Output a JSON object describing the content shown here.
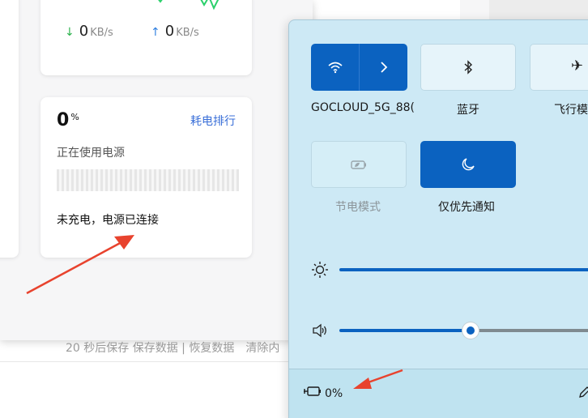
{
  "app": {
    "network": {
      "download_value": "0",
      "download_unit": "KB/s",
      "upload_value": "0",
      "upload_unit": "KB/s",
      "download_icon": "arrow-down-icon",
      "upload_icon": "arrow-up-icon"
    },
    "power": {
      "percent_value": "0",
      "percent_sign": "%",
      "rank_link": "耗电排行",
      "using_label": "正在使用电源",
      "status": "未充电，电源已连接"
    },
    "footer_text": "20 秒后保存 保存数据 | 恢复数据　清除内"
  },
  "quick_settings": {
    "tiles": [
      {
        "id": "wifi",
        "label": "GOCLOUD_5G_88(",
        "icon": "wifi-icon",
        "state": "on"
      },
      {
        "id": "bluetooth",
        "label": "蓝牙",
        "icon": "bluetooth-icon",
        "state": "off"
      },
      {
        "id": "airplane",
        "label": "飞行模",
        "icon": "airplane-icon",
        "state": "off"
      },
      {
        "id": "battery_saver",
        "label": "节电模式",
        "icon": "battery-saver-icon",
        "state": "disabled"
      },
      {
        "id": "focus_assist",
        "label": "仅优先通知",
        "icon": "moon-icon",
        "state": "on"
      }
    ],
    "brightness_icon": "sun-icon",
    "volume_icon": "speaker-icon",
    "brightness_level": 1.0,
    "volume_level": 0.5,
    "battery_percent": "0%",
    "battery_icon": "battery-plug-icon",
    "edit_icon": "pencil-icon"
  },
  "colors": {
    "accent": "#0b62c0",
    "panel": "#cde9f5",
    "download": "#2bb24c",
    "upload": "#2f7fe0",
    "link": "#3a6fd8",
    "annotation_arrow": "#e8432e"
  }
}
